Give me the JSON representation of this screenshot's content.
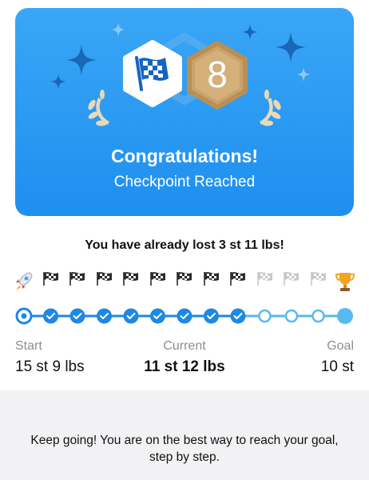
{
  "hero": {
    "badge_number": "8",
    "title": "Congratulations!",
    "subtitle": "Checkpoint Reached",
    "color_start": "#3aa6f5",
    "color_end": "#1e8ff0",
    "gold": "#c9a36a"
  },
  "progress": {
    "lost_message": "You have already lost 3 st 11 lbs!",
    "start_icon": "rocket-icon",
    "goal_icon": "trophy-icon",
    "checkpoints_total": 11,
    "checkpoints_reached": 8,
    "start_label": "Start",
    "current_label": "Current",
    "goal_label": "Goal",
    "start_value": "15 st 9 lbs",
    "current_value": "11 st 12 lbs",
    "goal_value": "10 st",
    "track_color": "#1e88e5",
    "track_light_color": "#5ab8f0"
  },
  "footer": {
    "message": "Keep going! You are on the best way to reach your goal, step by step."
  }
}
